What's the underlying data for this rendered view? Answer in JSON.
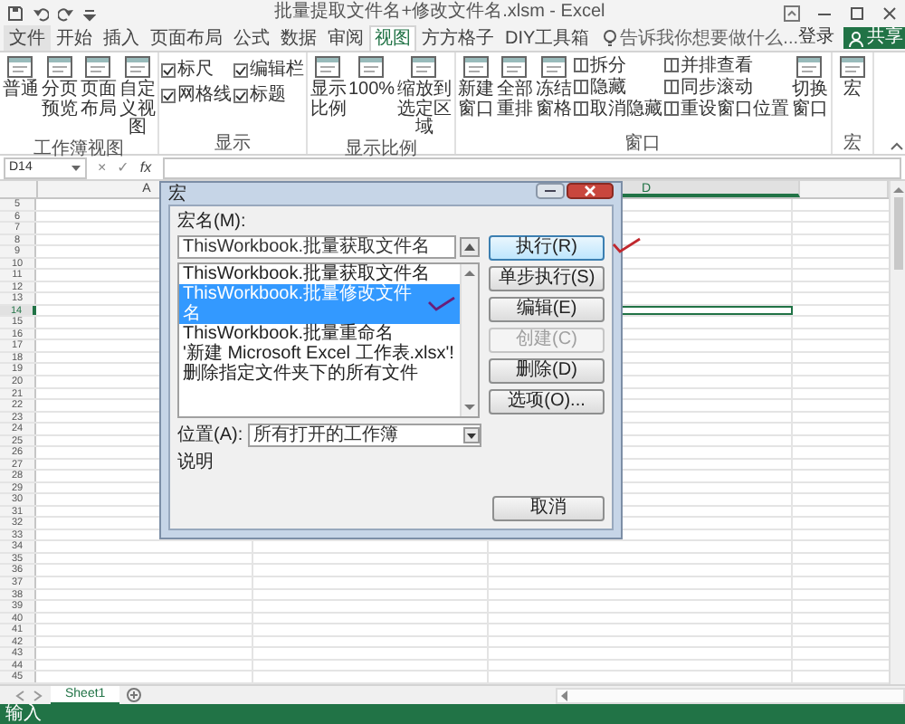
{
  "window": {
    "title": "批量提取文件名+修改文件名.xlsm - Excel"
  },
  "ribbon_tabs": [
    {
      "label": "文件",
      "kind": "file",
      "selected": false
    },
    {
      "label": "开始",
      "kind": "tab",
      "selected": false
    },
    {
      "label": "插入",
      "kind": "tab",
      "selected": false
    },
    {
      "label": "页面布局",
      "kind": "tab",
      "selected": false
    },
    {
      "label": "公式",
      "kind": "tab",
      "selected": false
    },
    {
      "label": "数据",
      "kind": "tab",
      "selected": false
    },
    {
      "label": "审阅",
      "kind": "tab",
      "selected": false
    },
    {
      "label": "视图",
      "kind": "tab",
      "selected": true
    },
    {
      "label": "方方格子",
      "kind": "tab",
      "selected": false
    },
    {
      "label": "DIY工具箱",
      "kind": "tab",
      "selected": false
    }
  ],
  "tell_me": {
    "placeholder": "告诉我你想要做什么..."
  },
  "account": {
    "sign_in": "登录",
    "share": "共享"
  },
  "ribbon_groups": [
    {
      "label": "工作簿视图",
      "items": [
        {
          "kind": "large",
          "label": "普通"
        },
        {
          "kind": "large",
          "label": "分页预览"
        },
        {
          "kind": "large",
          "label": "页面布局"
        },
        {
          "kind": "large",
          "label": "自定义视图"
        }
      ]
    },
    {
      "label": "显示",
      "items": [
        {
          "kind": "check",
          "label": "标尺",
          "checked": true
        },
        {
          "kind": "check",
          "label": "网格线",
          "checked": true
        },
        {
          "kind": "check",
          "label": "编辑栏",
          "checked": true
        },
        {
          "kind": "check",
          "label": "标题",
          "checked": true
        }
      ]
    },
    {
      "label": "显示比例",
      "items": [
        {
          "kind": "large",
          "label": "显示比例"
        },
        {
          "kind": "large",
          "label": "100%"
        },
        {
          "kind": "large",
          "label": "缩放到选定区域"
        }
      ]
    },
    {
      "label": "窗口",
      "items": [
        {
          "kind": "large",
          "label": "新建窗口"
        },
        {
          "kind": "large",
          "label": "全部重排"
        },
        {
          "kind": "large",
          "label": "冻结窗格"
        },
        {
          "kind": "small",
          "label": "拆分"
        },
        {
          "kind": "small",
          "label": "隐藏"
        },
        {
          "kind": "small",
          "label": "取消隐藏"
        },
        {
          "kind": "small",
          "label": "并排查看"
        },
        {
          "kind": "small",
          "label": "同步滚动"
        },
        {
          "kind": "small",
          "label": "重设窗口位置"
        },
        {
          "kind": "large",
          "label": "切换窗口"
        }
      ]
    },
    {
      "label": "宏",
      "items": [
        {
          "kind": "large",
          "label": "宏"
        }
      ]
    }
  ],
  "formula_bar": {
    "name_box": "D14",
    "cancel_symbol": "×",
    "enter_symbol": "✓",
    "function_symbol": "fx"
  },
  "columns": [
    {
      "label": "A",
      "selected": false
    },
    {
      "label": "D",
      "selected": true
    }
  ],
  "rows": [
    {
      "label": "5",
      "selected": false
    },
    {
      "label": "6",
      "selected": false
    },
    {
      "label": "7",
      "selected": false
    },
    {
      "label": "8",
      "selected": false
    },
    {
      "label": "9",
      "selected": false
    },
    {
      "label": "10",
      "selected": false
    },
    {
      "label": "11",
      "selected": false
    },
    {
      "label": "12",
      "selected": false
    },
    {
      "label": "13",
      "selected": false
    },
    {
      "label": "14",
      "selected": true
    },
    {
      "label": "15",
      "selected": false
    },
    {
      "label": "16",
      "selected": false
    },
    {
      "label": "17",
      "selected": false
    },
    {
      "label": "18",
      "selected": false
    },
    {
      "label": "19",
      "selected": false
    },
    {
      "label": "20",
      "selected": false
    },
    {
      "label": "21",
      "selected": false
    },
    {
      "label": "22",
      "selected": false
    },
    {
      "label": "23",
      "selected": false
    },
    {
      "label": "24",
      "selected": false
    },
    {
      "label": "25",
      "selected": false
    },
    {
      "label": "26",
      "selected": false
    },
    {
      "label": "27",
      "selected": false
    },
    {
      "label": "28",
      "selected": false
    },
    {
      "label": "29",
      "selected": false
    },
    {
      "label": "30",
      "selected": false
    },
    {
      "label": "31",
      "selected": false
    },
    {
      "label": "32",
      "selected": false
    },
    {
      "label": "33",
      "selected": false
    },
    {
      "label": "34",
      "selected": false
    },
    {
      "label": "35",
      "selected": false
    },
    {
      "label": "36",
      "selected": false
    },
    {
      "label": "37",
      "selected": false
    },
    {
      "label": "38",
      "selected": false
    },
    {
      "label": "39",
      "selected": false
    },
    {
      "label": "40",
      "selected": false
    },
    {
      "label": "41",
      "selected": false
    },
    {
      "label": "42",
      "selected": false
    },
    {
      "label": "43",
      "selected": false
    },
    {
      "label": "44",
      "selected": false
    },
    {
      "label": "45",
      "selected": false
    }
  ],
  "sheet_tabs": [
    {
      "label": "Sheet1",
      "selected": true
    }
  ],
  "status_bar": {
    "mode": "输入"
  },
  "macro_dialog": {
    "title": "宏",
    "name_label": "宏名(M):",
    "name_value": "ThisWorkbook.批量获取文件名",
    "macros": [
      {
        "label": "ThisWorkbook.批量获取文件名",
        "selected": false
      },
      {
        "label": "ThisWorkbook.批量修改文件名",
        "selected": true
      },
      {
        "label": "ThisWorkbook.批量重命名",
        "selected": false
      },
      {
        "label": "'新建 Microsoft Excel 工作表.xlsx'!删除指定文件夹下的所有文件",
        "selected": false
      }
    ],
    "buttons": [
      {
        "label": "执行(R)",
        "default": true,
        "disabled": false
      },
      {
        "label": "单步执行(S)",
        "default": false,
        "disabled": false
      },
      {
        "label": "编辑(E)",
        "default": false,
        "disabled": false
      },
      {
        "label": "创建(C)",
        "default": false,
        "disabled": true
      },
      {
        "label": "删除(D)",
        "default": false,
        "disabled": false
      },
      {
        "label": "选项(O)...",
        "default": false,
        "disabled": false
      }
    ],
    "location_label": "位置(A):",
    "location_value": "所有打开的工作簿",
    "description_label": "说明",
    "cancel": "取消"
  }
}
